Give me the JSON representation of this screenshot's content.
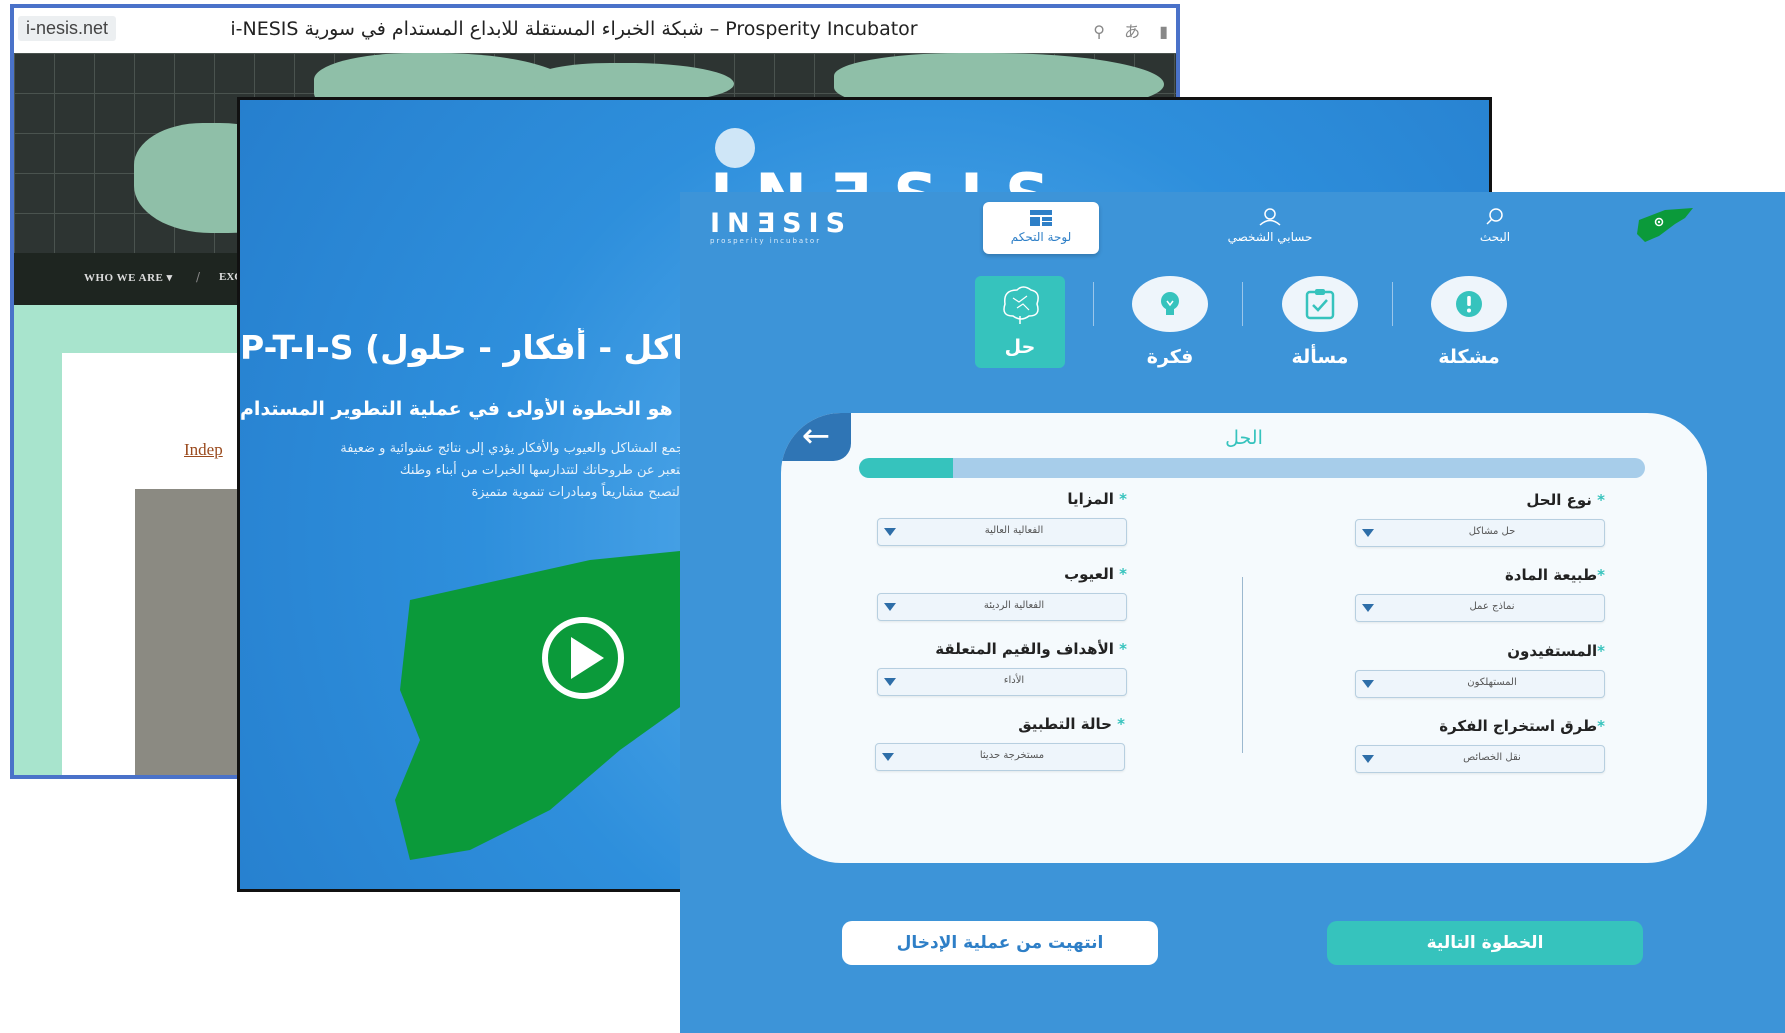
{
  "browser": {
    "domain": "i-nesis.net",
    "title": "i-NESIS شبكة الخبراء المستقلة للابداع المستدام في سورية – Prosperity Incubator",
    "nav": {
      "who_we_are": "WHO WE ARE",
      "separator": "/",
      "exc": "EXC"
    },
    "indep_link": "Indep"
  },
  "video": {
    "logo": "INƎSIS",
    "heading": "P-T-I-S (مشاكل - أفكار - حلول)",
    "subheading": "منهجة هو الخطوة الأولى في عملية التطوير المستدام",
    "paragraph": [
      "جمع المشاكل والعيوب والأفكار يؤدي إلى نتائج عشوائية و ضعيفة",
      "لتعبر عن طروحاتك لتتدارسها الخبرات من أبناء وطنك",
      "لتصبح مشاريعاً ومبادرات تنموية متميزة."
    ],
    "play_icon": "play-icon"
  },
  "app": {
    "logo": {
      "text": "INƎSIS",
      "subtitle": "prosperity incubator"
    },
    "nav": {
      "dashboard": "لوحة التحكم",
      "profile": "حسابي الشخصي",
      "search": "البحث"
    },
    "steps": [
      {
        "label": "حل",
        "icon": "brain-icon",
        "active": true
      },
      {
        "label": "فكرة",
        "icon": "lightbulb-icon",
        "active": false
      },
      {
        "label": "مسألة",
        "icon": "clipboard-check-icon",
        "active": false
      },
      {
        "label": "مشكلة",
        "icon": "exclamation-icon",
        "active": false
      }
    ],
    "form": {
      "title": "الحل",
      "progress": 0.12,
      "fields_right": [
        {
          "label": "نوع الحل",
          "value": "حل مشاكل"
        },
        {
          "label": "طبيعة المادة",
          "value": "نماذج عمل"
        },
        {
          "label": "المستفيدون",
          "value": "المستهلكون"
        },
        {
          "label": "طرق استخراج الفكرة",
          "value": "نقل الخصائص"
        }
      ],
      "fields_left": [
        {
          "label": "المزايا",
          "value": "الفعالية العالية"
        },
        {
          "label": "العيوب",
          "value": "الفعالية الرديئة"
        },
        {
          "label": "الأهداف والقيم المتعلقة",
          "value": "الأداء"
        },
        {
          "label": "حالة التطبيق",
          "value": "مستخرجة حديثا"
        }
      ],
      "required_mark": "*"
    },
    "buttons": {
      "finish": "انتهيت من عملية الإدخال",
      "next": "الخطوة التالية"
    },
    "colors": {
      "primary": "#3d94d8",
      "accent": "#36c3bd",
      "dark": "#2f75b5"
    }
  }
}
